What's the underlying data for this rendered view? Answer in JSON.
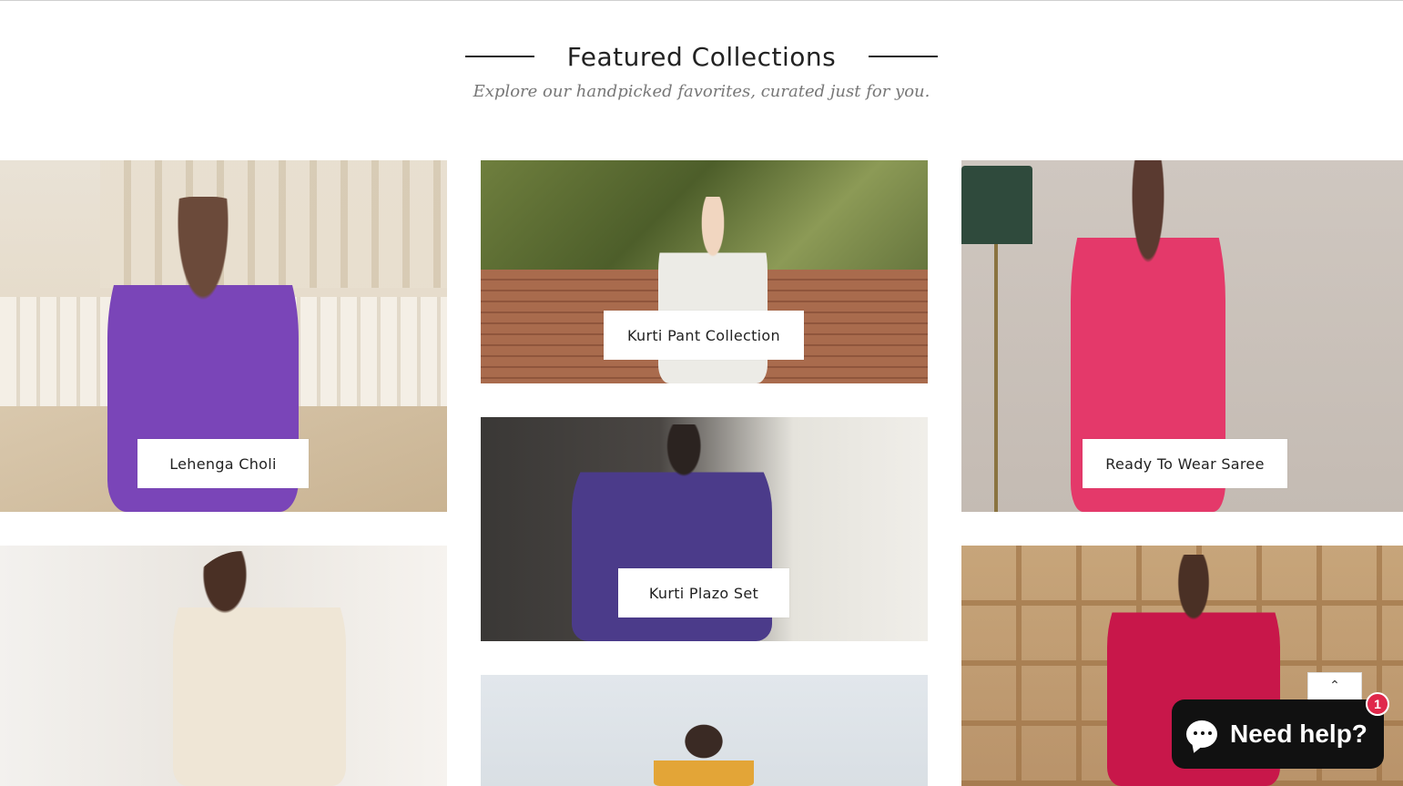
{
  "section": {
    "title": "Featured Collections",
    "subtitle": "Explore our handpicked favorites, curated just for you."
  },
  "collections": [
    {
      "label": "Lehenga Choli"
    },
    {
      "label": "Kurti Pant Collection"
    },
    {
      "label": "Ready To Wear Saree"
    },
    {
      "label": "Kurti Plazo Set"
    },
    {
      "label": ""
    },
    {
      "label": ""
    },
    {
      "label": ""
    }
  ],
  "back_to_top": {
    "icon": "chevron-up-icon",
    "glyph": "⌃"
  },
  "chat": {
    "label": "Need help?",
    "badge_count": "1",
    "icon": "chat-bubble-icon",
    "badge_color": "#e0284b"
  },
  "colors": {
    "text": "#222222",
    "subtitle": "#777777",
    "chat_bg": "#111111"
  }
}
